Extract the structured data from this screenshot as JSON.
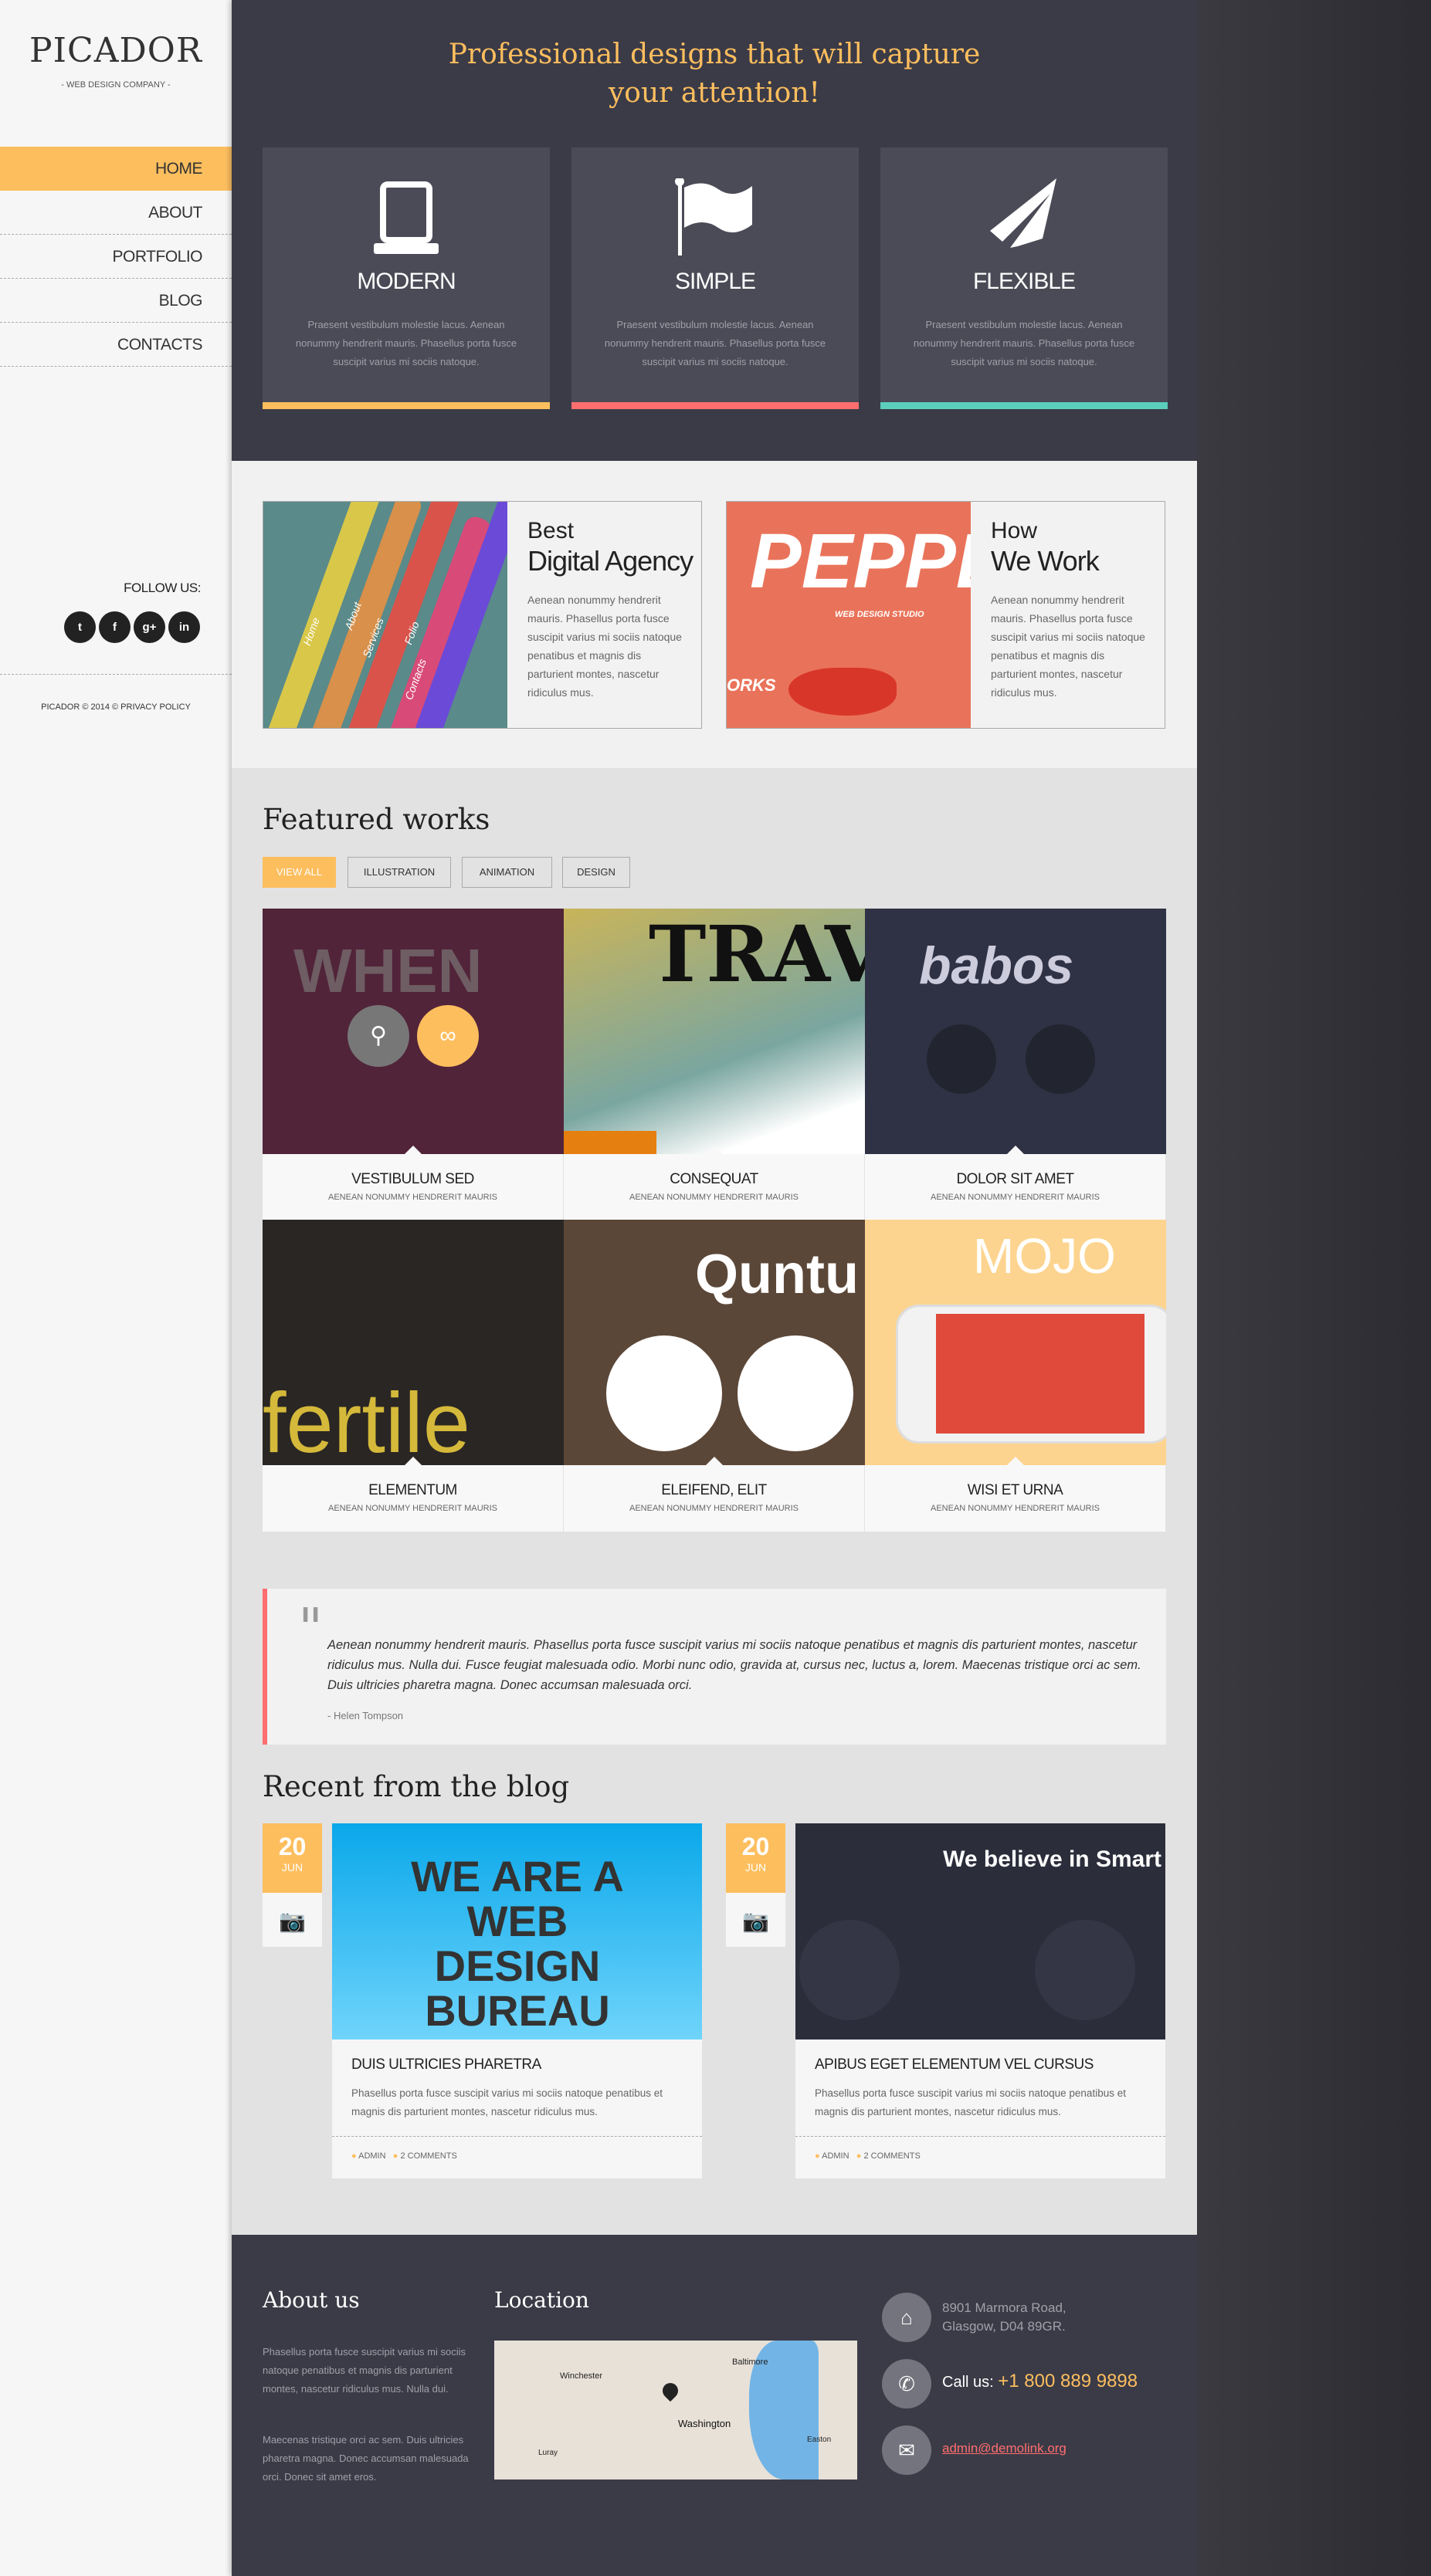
{
  "sidebar": {
    "logo": "PICADOR",
    "tagline": "- WEB DESIGN COMPANY -",
    "nav": [
      {
        "label": "HOME",
        "active": true
      },
      {
        "label": "ABOUT"
      },
      {
        "label": "PORTFOLIO"
      },
      {
        "label": "BLOG"
      },
      {
        "label": "CONTACTS"
      }
    ],
    "follow_label": "FOLLOW US:",
    "social": [
      {
        "icon": "twitter-icon",
        "glyph": "t"
      },
      {
        "icon": "facebook-icon",
        "glyph": "f"
      },
      {
        "icon": "google-plus-icon",
        "glyph": "g+"
      },
      {
        "icon": "linkedin-icon",
        "glyph": "in"
      }
    ],
    "copyright": "PICADOR © 2014 © PRIVACY POLICY"
  },
  "hero": {
    "title_line1": "Professional designs that will capture",
    "title_line2": "your attention!",
    "features": [
      {
        "icon": "laptop-icon",
        "title": "MODERN",
        "text": "Praesent vestibulum molestie lacus. Aenean nonummy hendrerit mauris. Phasellus porta fusce suscipit varius mi sociis natoque.",
        "color": "#fdbe5e"
      },
      {
        "icon": "flag-icon",
        "title": "SIMPLE",
        "text": "Praesent vestibulum molestie lacus. Aenean nonummy hendrerit mauris. Phasellus porta fusce suscipit varius mi sociis natoque.",
        "color": "#ff6e6e"
      },
      {
        "icon": "paper-plane-icon",
        "title": "FLEXIBLE",
        "text": "Praesent vestibulum molestie lacus. Aenean nonummy hendrerit mauris. Phasellus porta fusce suscipit varius mi sociis natoque.",
        "color": "#5bcfbb"
      }
    ]
  },
  "promos": [
    {
      "line1": "Best",
      "line2": "Digital Agency",
      "text": "Aenean nonummy hendrerit mauris. Phasellus porta fusce suscipit varius mi sociis natoque penatibus et magnis dis parturient montes, nascetur ridiculus mus.",
      "image_words": [
        "Home",
        "About",
        "Services",
        "Folio",
        "Contacts"
      ]
    },
    {
      "line1": "How",
      "line2": "We Work",
      "text": "Aenean nonummy hendrerit mauris. Phasellus porta fusce suscipit varius mi sociis natoque penatibus et magnis dis parturient montes, nascetur ridiculus mus.",
      "image_words": [
        "PEPPER",
        "WEB DESIGN STUDIO",
        "ORKS"
      ]
    }
  ],
  "featured": {
    "title": "Featured works",
    "filters": [
      {
        "label": "VIEW ALL",
        "active": true
      },
      {
        "label": "ILLUSTRATION"
      },
      {
        "label": "ANIMATION"
      },
      {
        "label": "DESIGN"
      }
    ],
    "works": [
      {
        "title": "VESTIBULUM SED",
        "subtitle": "AENEAN NONUMMY HENDRERIT MAURIS",
        "image_text": "WHEN"
      },
      {
        "title": "CONSEQUAT",
        "subtitle": "AENEAN NONUMMY HENDRERIT MAURIS",
        "image_text": "TRAV"
      },
      {
        "title": "DOLOR SIT AMET",
        "subtitle": "AENEAN NONUMMY HENDRERIT MAURIS",
        "image_text": "babos"
      },
      {
        "title": "ELEMENTUM",
        "subtitle": "AENEAN NONUMMY HENDRERIT MAURIS",
        "image_text": "fertile"
      },
      {
        "title": "ELEIFEND, ELIT",
        "subtitle": "AENEAN NONUMMY HENDRERIT MAURIS",
        "image_text": "Quntu"
      },
      {
        "title": "WISI ET URNA",
        "subtitle": "AENEAN NONUMMY HENDRERIT MAURIS",
        "image_text": "MOJO"
      }
    ]
  },
  "testimonial": {
    "text": "Aenean nonummy hendrerit mauris. Phasellus porta fusce suscipit varius mi sociis natoque penatibus et magnis dis parturient montes, nascetur ridiculus mus. Nulla dui. Fusce feugiat malesuada odio. Morbi nunc odio, gravida at, cursus nec, luctus a, lorem. Maecenas tristique orci ac sem. Duis ultricies pharetra magna. Donec accumsan malesuada orci.",
    "author": "- Helen Tompson"
  },
  "blog": {
    "title": "Recent from the blog",
    "posts": [
      {
        "day": "20",
        "month": "JUN",
        "title": "DUIS ULTRICIES PHARETRA",
        "text": "Phasellus porta fusce suscipit varius mi sociis natoque penatibus et magnis dis parturient montes, nascetur ridiculus mus.",
        "author": "ADMIN",
        "comments": "2 COMMENTS",
        "image_text": "WE ARE A WEB DESIGN BUREAU"
      },
      {
        "day": "20",
        "month": "JUN",
        "title": "APIBUS EGET ELEMENTUM VEL CURSUS",
        "text": "Phasellus porta fusce suscipit varius mi sociis natoque penatibus et magnis dis parturient montes, nascetur ridiculus mus.",
        "author": "ADMIN",
        "comments": "2 COMMENTS",
        "image_text": "We believe in Smart"
      }
    ]
  },
  "footer": {
    "about_title": "About us",
    "about_p1": "Phasellus porta fusce suscipit varius mi sociis natoque penatibus et magnis dis parturient montes, nascetur ridiculus mus. Nulla dui.",
    "about_p2": "Maecenas tristique orci ac sem. Duis ultricies pharetra magna. Donec accumsan malesuada orci. Donec sit amet eros.",
    "location_title": "Location",
    "map_labels": [
      "Baltimore",
      "Winchester",
      "Washington",
      "Easton",
      "Luray"
    ],
    "address_line1": "8901 Marmora Road,",
    "address_line2": "Glasgow, D04 89GR.",
    "call_label": "Call us:",
    "phone": "+1 800 889 9898",
    "email": "admin@demolink.org"
  },
  "colors": {
    "accent": "#fdbe5e",
    "red": "#ff6e6e",
    "teal": "#5bcfbb",
    "dark": "#3b3b47"
  }
}
